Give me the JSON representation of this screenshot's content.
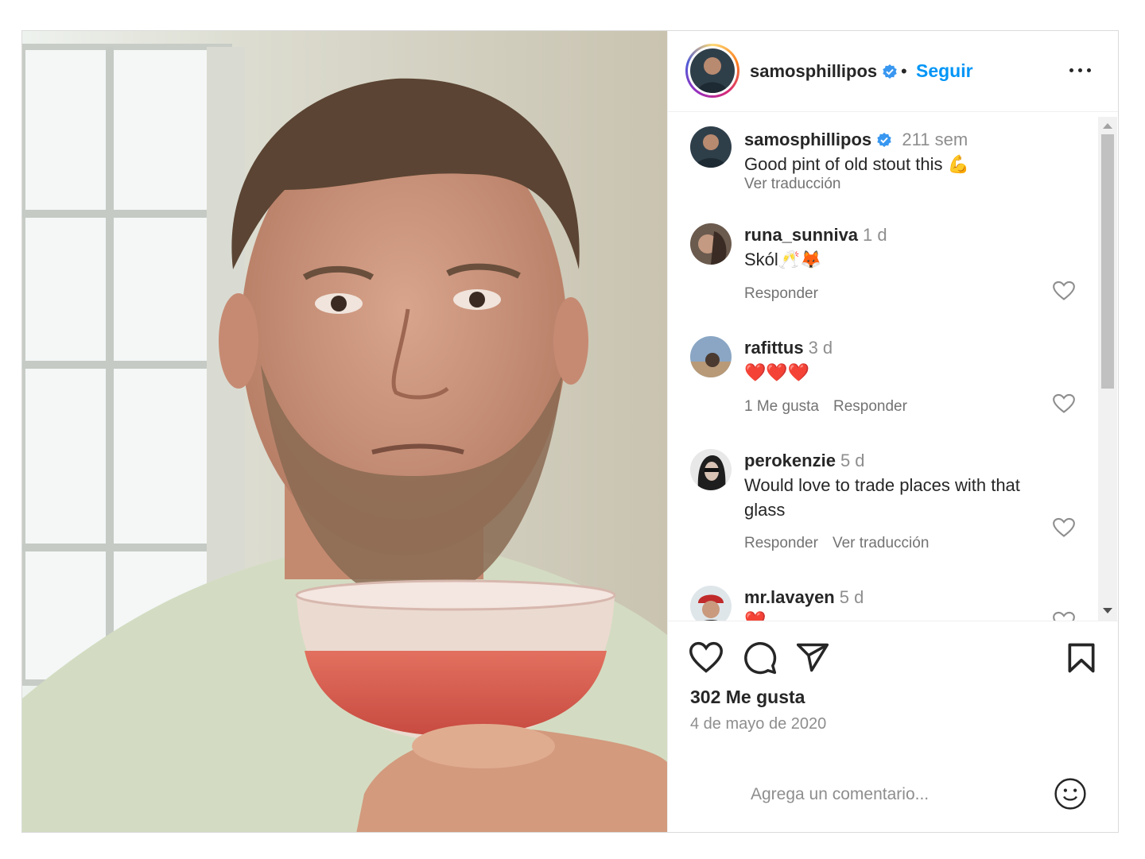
{
  "post": {
    "author": "samosphillipos",
    "follow_label": "Seguir",
    "separator": "•",
    "photo_alt": "Selfie con copa"
  },
  "caption": {
    "user": "samosphillipos",
    "time": "211 sem",
    "text": "Good pint of old stout this 💪",
    "translate": "Ver traducción"
  },
  "comments": [
    {
      "user": "runa_sunniva",
      "time": "1 d",
      "text": "Skól🥂🦊",
      "meta": [
        "Responder"
      ]
    },
    {
      "user": "rafittus",
      "time": "3 d",
      "text": "❤️❤️❤️",
      "meta": [
        "1 Me gusta",
        "Responder"
      ]
    },
    {
      "user": "perokenzie",
      "time": "5 d",
      "text": "Would love to trade places with that glass",
      "meta": [
        "Responder",
        "Ver traducción"
      ]
    },
    {
      "user": "mr.lavayen",
      "time": "5 d",
      "text": "❤️",
      "meta": []
    }
  ],
  "stats": {
    "likes": "302 Me gusta",
    "date": "4 de mayo de 2020"
  },
  "add_comment": {
    "placeholder": "Agrega un comentario..."
  },
  "colors": {
    "accent": "#0095f6",
    "verified": "#3897f0",
    "muted": "#8e8e8e",
    "text": "#262626"
  },
  "icons": [
    "more-options-icon",
    "verified-icon",
    "heart-icon",
    "comment-icon",
    "share-icon",
    "bookmark-icon",
    "emoji-icon"
  ]
}
